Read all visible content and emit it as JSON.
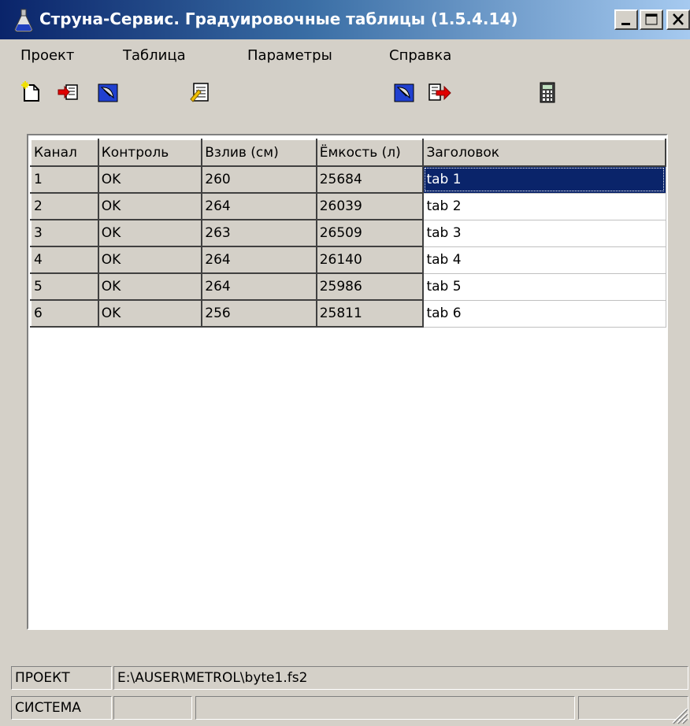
{
  "window": {
    "title": "Струна-Сервис. Градуировочные таблицы  (1.5.4.14)"
  },
  "menu": [
    {
      "label": "Проект"
    },
    {
      "label": "Таблица"
    },
    {
      "label": "Параметры"
    },
    {
      "label": "Справка"
    }
  ],
  "toolbar": [
    {
      "icon": "new-project-icon"
    },
    {
      "icon": "import-icon"
    },
    {
      "icon": "satellite-dish-icon"
    },
    {
      "icon": "edit-table-icon"
    },
    {
      "icon": "satellite-dish-icon"
    },
    {
      "icon": "export-icon"
    },
    {
      "icon": "calculator-icon"
    }
  ],
  "grid": {
    "headers": [
      "Канал",
      "Контроль",
      "Взлив (см)",
      "Ёмкость (л)",
      "Заголовок"
    ],
    "rows": [
      [
        "1",
        "OK",
        "260",
        "25684",
        "tab 1"
      ],
      [
        "2",
        "OK",
        "264",
        "26039",
        "tab 2"
      ],
      [
        "3",
        "OK",
        "263",
        "26509",
        "tab 3"
      ],
      [
        "4",
        "OK",
        "264",
        "26140",
        "tab 4"
      ],
      [
        "5",
        "OK",
        "264",
        "25986",
        "tab 5"
      ],
      [
        "6",
        "OK",
        "256",
        "25811",
        "tab 6"
      ]
    ],
    "selected_cell": "tab 1"
  },
  "statusbar": {
    "project_label": "ПРОЕКТ",
    "project_path": "E:\\AUSER\\METROL\\byte1.fs2",
    "system_label": "СИСТЕМА"
  },
  "colors": {
    "title_start": "#0a246a",
    "title_end": "#a6caf0",
    "face": "#d4d0c8",
    "selection": "#0a246a"
  }
}
